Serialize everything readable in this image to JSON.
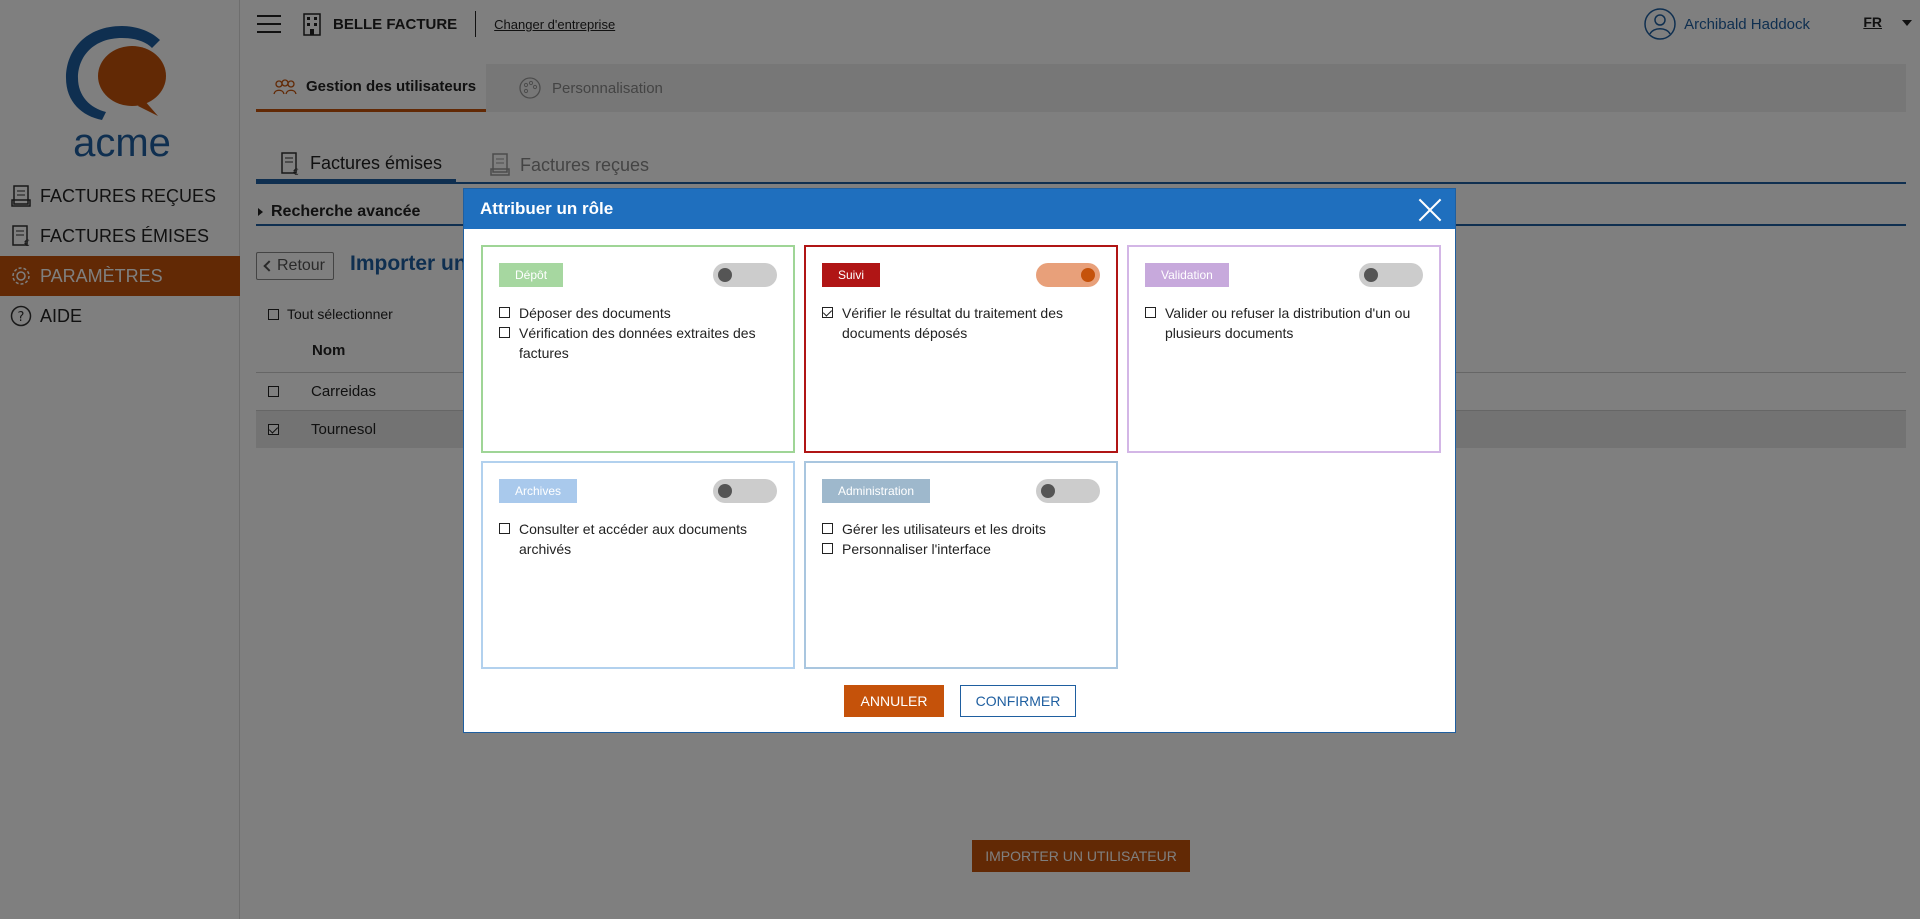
{
  "sidebar": {
    "logo_text": "acme",
    "items": [
      {
        "label": "FACTURES REÇUES",
        "icon": "invoice-received-icon"
      },
      {
        "label": "FACTURES ÉMISES",
        "icon": "invoice-issued-icon"
      },
      {
        "label": "PARAMÈTRES",
        "icon": "gear-icon",
        "active": true
      },
      {
        "label": "AIDE",
        "icon": "help-icon"
      }
    ]
  },
  "topbar": {
    "company_name": "BELLE FACTURE",
    "change_company_label": "Changer d'entreprise",
    "user_name": "Archibald Haddock",
    "language": "FR"
  },
  "main_tabs": [
    {
      "label": "Gestion des utilisateurs",
      "active": true
    },
    {
      "label": "Personnalisation",
      "active": false
    }
  ],
  "sub_tabs": [
    {
      "label": "Factures émises",
      "active": true
    },
    {
      "label": "Factures reçues",
      "active": false
    }
  ],
  "advanced_search_label": "Recherche avancée",
  "back_label": "Retour",
  "page_title": "Importer un",
  "select_all_label": "Tout sélectionner",
  "table": {
    "column_name": "Nom",
    "rows": [
      {
        "name": "Carreidas",
        "checked": false
      },
      {
        "name": "Tournesol",
        "checked": true
      }
    ]
  },
  "import_button_label": "IMPORTER UN UTILISATEUR",
  "modal": {
    "title": "Attribuer un rôle",
    "roles": [
      {
        "label": "Dépôt",
        "color": "#a6d7a0",
        "border": "#9fd596",
        "on": false,
        "permissions": [
          {
            "text": "Déposer des documents",
            "checked": false
          },
          {
            "text": "Vérification des données extraites des factures",
            "checked": false
          }
        ]
      },
      {
        "label": "Suivi",
        "color": "#b01515",
        "border": "#b01515",
        "on": true,
        "permissions": [
          {
            "text": "Vérifier le résultat du traitement des documents déposés",
            "checked": true
          }
        ]
      },
      {
        "label": "Validation",
        "color": "#c7a9dc",
        "border": "#d3b6e6",
        "on": false,
        "permissions": [
          {
            "text": "Valider ou refuser la distribution d'un ou plusieurs documents",
            "checked": false
          }
        ]
      },
      {
        "label": "Archives",
        "color": "#a9c9ec",
        "border": "#b2d1ee",
        "on": false,
        "permissions": [
          {
            "text": "Consulter et accéder aux documents archivés",
            "checked": false
          }
        ]
      },
      {
        "label": "Administration",
        "color": "#9eb8cc",
        "border": "#a9c6df",
        "on": false,
        "permissions": [
          {
            "text": "Gérer les utilisateurs et les droits",
            "checked": false
          },
          {
            "text": "Personnaliser l'interface",
            "checked": false
          }
        ]
      }
    ],
    "cancel_label": "ANNULER",
    "confirm_label": "CONFIRMER"
  },
  "colors": {
    "accent": "#c5520a",
    "primary": "#1f5fa0",
    "header": "#1f6fbe"
  }
}
